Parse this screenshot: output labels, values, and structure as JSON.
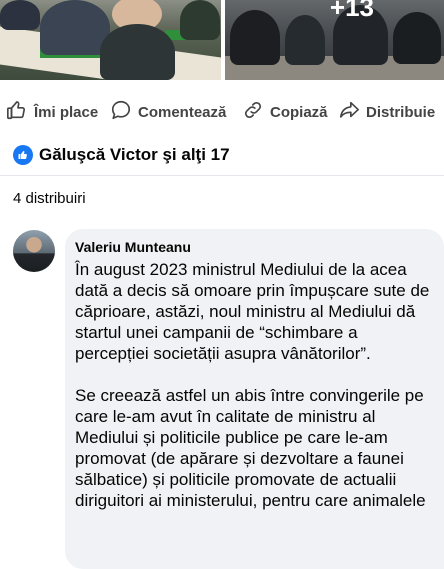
{
  "photos": {
    "more_count": "+13"
  },
  "actions": {
    "like_label": "Îmi place",
    "comment_label": "Comentează",
    "copy_label": "Copiază",
    "share_label": "Distribuie"
  },
  "reactions": {
    "names": "Găluşcă Victor şi alţi 17"
  },
  "shares": {
    "count_label": "4 distribuiri"
  },
  "comment": {
    "author": "Valeriu Munteanu",
    "text": "În august 2023 ministrul Mediului de la acea dată a decis să omoare prin împușcare sute de căprioare, astăzi, noul ministru al Mediului dă startul unei campanii de “schimbare a percepției societății asupra vânătorilor”.\n\nSe creează astfel un abis între convingerile pe care le-am avut în calitate de ministru al Mediului și politicile publice pe care le-am promovat (de apărare și dezvoltare a faunei sălbatice) și politicile promovate de actualii diriguitori ai ministerului, pentru care animalele"
  },
  "colors": {
    "accent": "#1877f2",
    "bubble": "#f0f2f5",
    "muted_text": "#444444"
  }
}
